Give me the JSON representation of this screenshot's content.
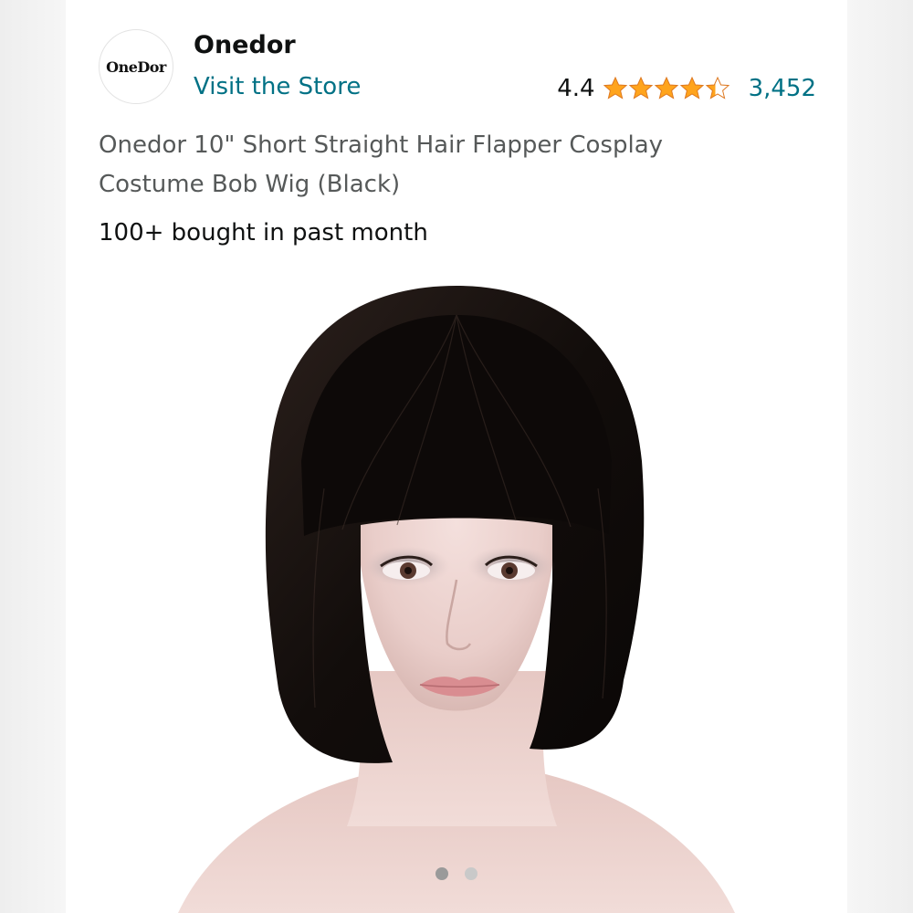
{
  "store": {
    "logo_text": "OneDor",
    "brand_name": "Onedor",
    "visit_label": "Visit the Store"
  },
  "rating": {
    "value": "4.4",
    "stars": 4.4,
    "review_count": "3,452",
    "star_color": "#ffa41c"
  },
  "product": {
    "title": "Onedor 10\" Short Straight Hair Flapper Cosplay Costume Bob Wig (Black)",
    "bought_text": "100+ bought in past month",
    "image_label": "black-bob-wig-on-mannequin-head"
  },
  "carousel": {
    "total_images": 2,
    "active_index": 0
  },
  "colors": {
    "link": "#007185",
    "text": "#0f1111",
    "secondary_text": "#565959"
  }
}
